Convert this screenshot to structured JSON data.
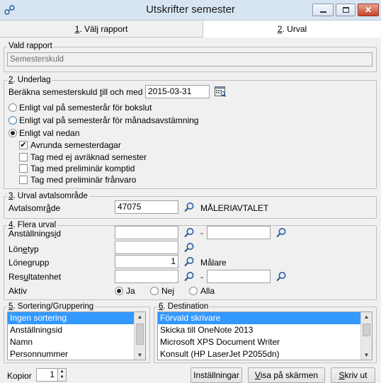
{
  "window": {
    "title": "Utskrifter semester"
  },
  "tabs": [
    {
      "mnemonic": "1",
      "rest": ". Välj rapport"
    },
    {
      "mnemonic": "2",
      "rest": ". Urval"
    }
  ],
  "vald_rapport": {
    "legend": "Vald rapport",
    "value": "Semesterskuld"
  },
  "underlag": {
    "legend_mn": "2",
    "legend_rest": ". Underlag",
    "date_label_a": "Beräkna semesterskuld ",
    "date_label_mn": "t",
    "date_label_b": "ill och med",
    "date_value": "2015-03-31",
    "options": [
      "Enligt val på semesterår för bokslut",
      "Enligt val på semesterår för månadsavstämning",
      "Enligt val nedan"
    ],
    "checks": [
      {
        "label": "Avrunda semesterdagar",
        "checked": true
      },
      {
        "label": "Tag med ej avräknad semester",
        "checked": false
      },
      {
        "label": "Tag med preliminär komptid",
        "checked": false
      },
      {
        "label": "Tag med preliminär frånvaro",
        "checked": false
      }
    ]
  },
  "avtal": {
    "legend_mn": "3",
    "legend_rest": ". Urval avtalsområde",
    "label_a": "Avtalsomr",
    "label_mn": "å",
    "label_b": "de",
    "value": "47075",
    "desc": "MÅLERIAVTALET"
  },
  "flera": {
    "legend_mn": "4",
    "legend_rest": ". Flera urval",
    "anst_a": "Anställnings",
    "anst_mn": "i",
    "anst_b": "d",
    "lone_a": "Lön",
    "lone_mn": "e",
    "lone_b": "typ",
    "grupp_label": "Lönegrupp",
    "grupp_value": "1",
    "grupp_desc": "Målare",
    "res_a": "Res",
    "res_mn": "u",
    "res_b": "ltatenhet",
    "dash": "-",
    "aktiv_label": "Aktiv",
    "aktiv_options": [
      "Ja",
      "Nej",
      "Alla"
    ]
  },
  "sortering": {
    "legend_mn": "5",
    "legend_rest": ". Sortering/Gruppering",
    "items": [
      "Ingen sortering",
      "Anställningsid",
      "Namn",
      "Personnummer"
    ]
  },
  "destination": {
    "legend_mn": "6",
    "legend_rest": ". Destination",
    "items": [
      "Förvald skrivare",
      "Skicka till OneNote 2013",
      "Microsoft XPS Document Writer",
      "Konsult (HP LaserJet P2055dn)"
    ]
  },
  "footer": {
    "kopior_label": "Kopior",
    "kopior_value": "1",
    "installningar": "Inställningar",
    "visa_mn": "V",
    "visa_rest": "isa på skärmen",
    "skriv_mn": "S",
    "skriv_rest": "kriv ut"
  }
}
